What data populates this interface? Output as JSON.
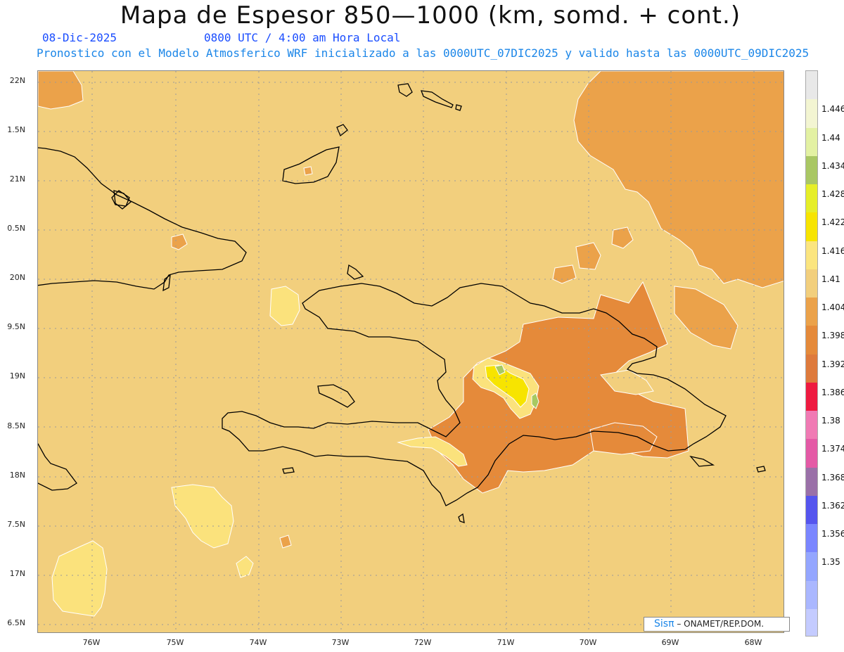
{
  "header": {
    "title": "Mapa de Espesor 850—1000 (km, somd. + cont.)",
    "date": "08-Dic-2025",
    "time": "0800 UTC / 4:00 am Hora Local",
    "info": "Pronostico con el Modelo Atmosferico WRF inicializado a las 0000UTC_07DIC2025 y valido hasta las  0000UTC_09DIC2025"
  },
  "map": {
    "lat_labels": [
      "22N",
      "1.5N",
      "21N",
      "0.5N",
      "20N",
      "9.5N",
      "19N",
      "8.5N",
      "18N",
      "7.5N",
      "17N",
      "6.5N"
    ],
    "lon_labels": [
      "76W",
      "75W",
      "74W",
      "73W",
      "72W",
      "71W",
      "70W",
      "69W",
      "68W"
    ],
    "fill_colors": {
      "base": "#f2cf7d",
      "orange": "#eba24a",
      "dark_orange": "#e58a3a",
      "light_yellow": "#fbe27c",
      "yellow": "#f7e400",
      "yellow_green": "#e6ee58",
      "green": "#a7c962"
    }
  },
  "colorbar": {
    "labels": [
      "1.446",
      "1.44",
      "1.434",
      "1.428",
      "1.422",
      "1.416",
      "1.41",
      "1.404",
      "1.398",
      "1.392",
      "1.386",
      "1.38",
      "1.374",
      "1.368",
      "1.362",
      "1.356",
      "1.35"
    ],
    "colors": [
      "#e8e8e8",
      "#f3f5d2",
      "#e3f1a3",
      "#a9c764",
      "#e6ee28",
      "#f7e400",
      "#fbe57f",
      "#f2cf7d",
      "#eba24a",
      "#e58a3a",
      "#de7a3c",
      "#ee1a40",
      "#f07ab4",
      "#e45aa6",
      "#9a70a8",
      "#5555ee",
      "#7a86ff",
      "#94a6ff",
      "#aab7ff",
      "#c4cbff"
    ]
  },
  "credit": {
    "logo": "Sisπ",
    "text": " – ONAMET/REP.DOM."
  }
}
